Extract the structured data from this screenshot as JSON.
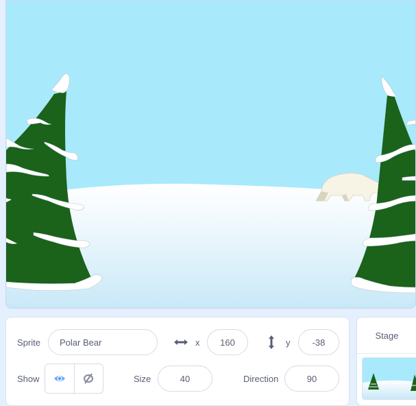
{
  "stage": {
    "backdrop": "winter-scene",
    "sprites": [
      {
        "name": "Polar Bear",
        "icon": "polar-bear-sprite"
      },
      {
        "name": "Tree Left",
        "icon": "snowy-pine-tree"
      },
      {
        "name": "Tree Right",
        "icon": "snowy-pine-tree"
      }
    ],
    "colors": {
      "sky": "#a9e9fc",
      "snow_top": "#ffffff",
      "snow_bottom": "#c8e8f7",
      "tree": "#1b621b",
      "snow_cap": "#ffffff"
    }
  },
  "sprite_info": {
    "sprite_label": "Sprite",
    "sprite_name": "Polar Bear",
    "x_icon": "horizontal-arrows-icon",
    "x_label": "x",
    "x_value": "160",
    "y_icon": "vertical-arrows-icon",
    "y_label": "y",
    "y_value": "-38",
    "show_label": "Show",
    "show_visible_icon": "eye-icon",
    "show_hidden_icon": "eye-slash-icon",
    "show_selected": "visible",
    "size_label": "Size",
    "size_value": "40",
    "direction_label": "Direction",
    "direction_value": "90"
  },
  "stage_panel": {
    "title": "Stage"
  },
  "accent_color": "#4c97ff",
  "text_color": "#575e75"
}
